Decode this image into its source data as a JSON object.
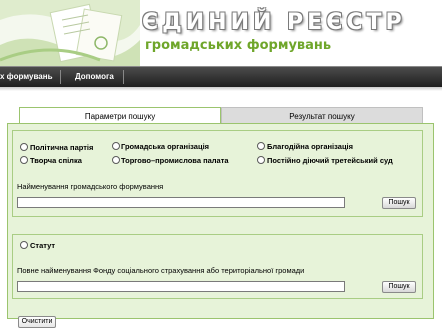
{
  "header": {
    "title": "ЄДИНИЙ РЕЄСТР",
    "subtitle": "громадських формувань"
  },
  "nav": {
    "items": [
      {
        "label": "х формувань"
      },
      {
        "label": "Допомога"
      }
    ]
  },
  "tabs": [
    {
      "label": "Параметри пошуку",
      "active": true
    },
    {
      "label": "Результат пошуку",
      "active": false
    }
  ],
  "search": {
    "types": [
      {
        "label": "Політична партія"
      },
      {
        "label": "Громадська організація"
      },
      {
        "label": "Благодійна організація"
      },
      {
        "label": "Творча спілка"
      },
      {
        "label": "Торгово–промислова палата"
      },
      {
        "label": "Постійно діючий третейський суд"
      }
    ],
    "name_label": "Найменування громадського формування",
    "name_value": "",
    "search_button": "Пошук"
  },
  "statute": {
    "radio_label": "Статут",
    "fund_label": "Повне найменування Фонду соціального страхування або територіальної громади",
    "fund_value": "",
    "search_button": "Пошук"
  },
  "actions": {
    "clear_button": "Очистити"
  },
  "colors": {
    "accent": "#6fa62a",
    "panel_bg": "#e7f3d9",
    "panel_border": "#9bc46e",
    "navbar": "#2a2a2a"
  }
}
